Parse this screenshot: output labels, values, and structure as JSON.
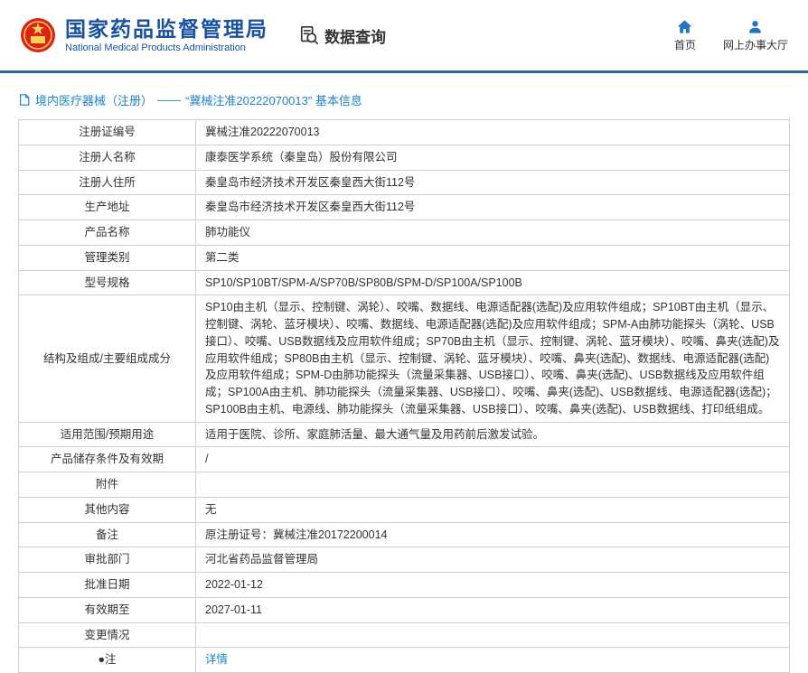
{
  "header": {
    "org_name_cn": "国家药品监督管理局",
    "org_name_en": "National Medical Products Administration",
    "nav_query_label": "数据查询",
    "home_label": "首页",
    "hall_label": "网上办事大厅"
  },
  "colors": {
    "title_blue": "#1a52a2",
    "link_blue": "#1e82c8",
    "divider_blue": "#2d66a5",
    "emblem_red": "#dd2318",
    "emblem_yellow": "#f7d257",
    "table_border": "#cfcfcf"
  },
  "breadcrumb": {
    "category": "境内医疗器械（注册）",
    "separator": "——",
    "title": "“冀械注准20222070013” 基本信息"
  },
  "table": {
    "rows": [
      {
        "label": "注册证编号",
        "value": "冀械注准20222070013"
      },
      {
        "label": "注册人名称",
        "value": "康泰医学系统（秦皇岛）股份有限公司"
      },
      {
        "label": "注册人住所",
        "value": "秦皇岛市经济技术开发区秦皇西大街112号"
      },
      {
        "label": "生产地址",
        "value": "秦皇岛市经济技术开发区秦皇西大街112号"
      },
      {
        "label": "产品名称",
        "value": "肺功能仪"
      },
      {
        "label": "管理类别",
        "value": "第二类"
      },
      {
        "label": "型号规格",
        "value": "SP10/SP10BT/SPM-A/SP70B/SP80B/SPM-D/SP100A/SP100B"
      },
      {
        "label": "结构及组成/主要组成成分",
        "value": "SP10由主机（显示、控制键、涡轮）、咬嘴、数据线、电源适配器(选配)及应用软件组成；SP10BT由主机（显示、控制键、涡轮、蓝牙模块）、咬嘴、数据线、电源适配器(选配)及应用软件组成；SPM-A由肺功能探头（涡轮、USB接口）、咬嘴、USB数据线及应用软件组成；SP70B由主机（显示、控制键、涡轮、蓝牙模块）、咬嘴、鼻夹(选配)及应用软件组成；SP80B由主机（显示、控制键、涡轮、蓝牙模块）、咬嘴、鼻夹(选配)、数据线、电源适配器(选配)及应用软件组成；SPM-D由肺功能探头（流量采集器、USB接口）、咬嘴、鼻夹(选配)、USB数据线及应用软件组成；SP100A由主机、肺功能探头（流量采集器、USB接口）、咬嘴、鼻夹(选配)、USB数据线、电源适配器(选配)；SP100B由主机、电源线、肺功能探头（流量采集器、USB接口）、咬嘴、鼻夹(选配)、USB数据线、打印纸组成。"
      },
      {
        "label": "适用范围/预期用途",
        "value": "适用于医院、诊所、家庭肺活量、最大通气量及用药前后激发试验。"
      },
      {
        "label": "产品储存条件及有效期",
        "value": "/"
      },
      {
        "label": "附件",
        "value": ""
      },
      {
        "label": "其他内容",
        "value": "无"
      },
      {
        "label": "备注",
        "value": "原注册证号：冀械注准20172200014"
      },
      {
        "label": "审批部门",
        "value": "河北省药品监督管理局"
      },
      {
        "label": "批准日期",
        "value": "2022-01-12"
      },
      {
        "label": "有效期至",
        "value": "2027-01-11"
      },
      {
        "label": "变更情况",
        "value": ""
      },
      {
        "label": "●注",
        "value": "详情",
        "link": true
      }
    ]
  }
}
